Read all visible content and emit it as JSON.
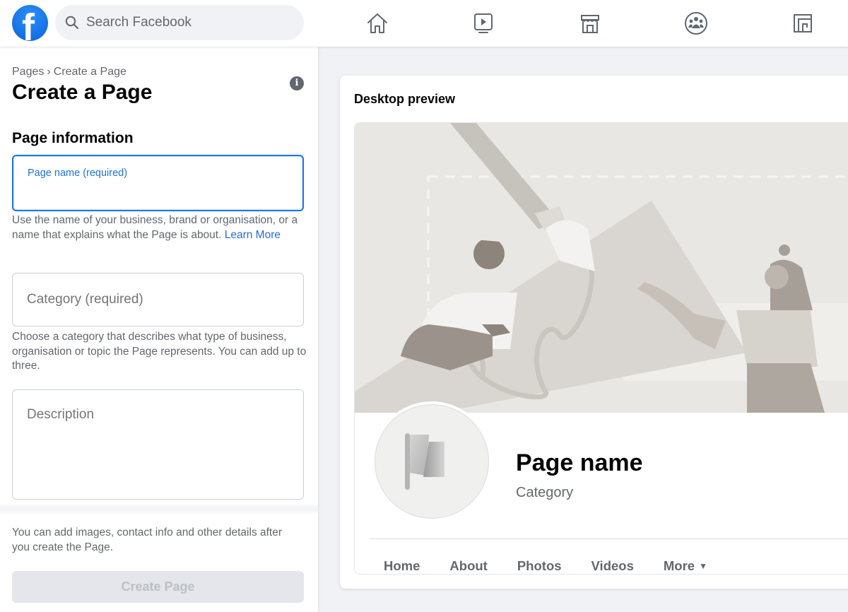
{
  "topbar": {
    "logo_letter": "f",
    "search_placeholder": "Search Facebook",
    "nav_icons": [
      "home-icon",
      "watch-icon",
      "marketplace-icon",
      "groups-icon",
      "gaming-icon"
    ]
  },
  "left": {
    "breadcrumb": {
      "parent": "Pages",
      "separator": "›",
      "current": "Create a Page"
    },
    "title": "Create a Page",
    "info_glyph": "i",
    "section_title": "Page information",
    "page_name": {
      "label": "Page name (required)",
      "value": ""
    },
    "page_name_help": "Use the name of your business, brand or organisation, or a name that explains what the Page is about.",
    "learn_more": "Learn More",
    "category": {
      "placeholder": "Category (required)",
      "value": ""
    },
    "category_help": "Choose a category that describes what type of business, organisation or topic the Page represents. You can add up to three.",
    "description": {
      "placeholder": "Description",
      "value": ""
    },
    "footer_note": "You can add images, contact info and other details after you create the Page.",
    "create_button": "Create Page"
  },
  "preview": {
    "title": "Desktop preview",
    "page_name": "Page name",
    "category": "Category",
    "tabs": [
      "Home",
      "About",
      "Photos",
      "Videos",
      "More"
    ],
    "more_caret": "▼"
  },
  "colors": {
    "brand_blue": "#1877f2",
    "link_blue": "#216fdb",
    "disabled_button_bg": "#e4e6eb",
    "disabled_button_text": "#bcc0c4"
  }
}
